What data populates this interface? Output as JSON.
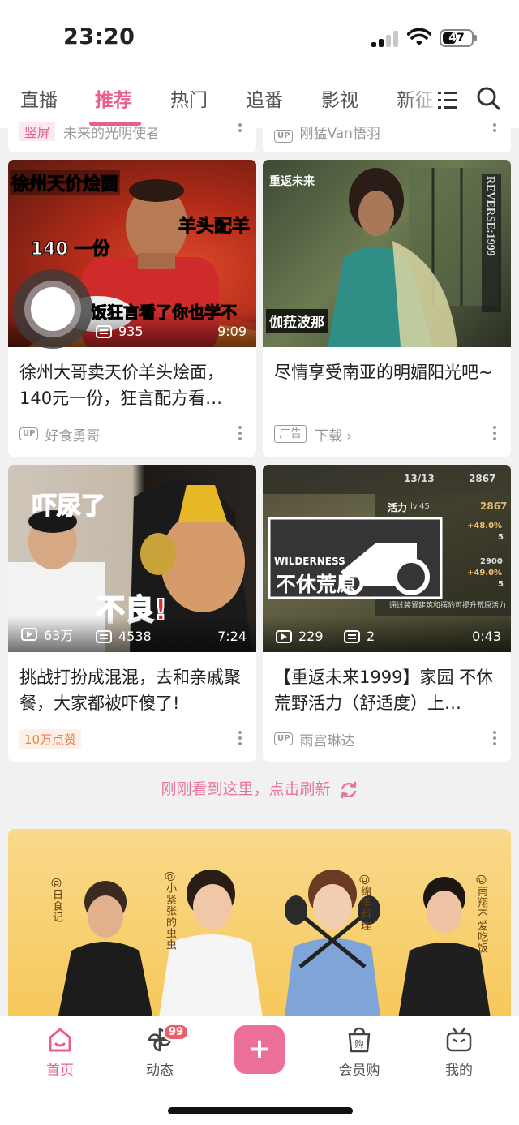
{
  "status_bar": {
    "time": "23:20",
    "battery": "47",
    "battery_level": 0.47
  },
  "tabs": [
    {
      "label": "直播"
    },
    {
      "label": "推荐"
    },
    {
      "label": "热门"
    },
    {
      "label": "追番"
    },
    {
      "label": "影视"
    },
    {
      "label": "新征"
    }
  ],
  "active_tab": "推荐",
  "top_remnants": {
    "left_tag": "竖屏",
    "left_text": "未来的光明使者",
    "right_text": "刚猛Van悟羽"
  },
  "cards": [
    {
      "overlay": [
        "徐州天价烩面",
        "140 一份",
        "羊头配羊",
        "饭狂言看了你也学不"
      ],
      "views": "",
      "danmaku": "935",
      "duration": "9:09",
      "title": "徐州大哥卖天价羊头烩面，140元一份，狂言配方看…",
      "author": "好食勇哥",
      "footer_type": "up"
    },
    {
      "overlay": [
        "重返未来",
        "REVERSE:1999",
        "伽菈波那"
      ],
      "views": "",
      "danmaku": "",
      "duration": "",
      "title": "尽情享受南亚的明媚阳光吧~",
      "ad_label": "广告",
      "ad_action": "下载 ›",
      "footer_type": "ad"
    },
    {
      "overlay": [
        "吓尿了",
        "不良!"
      ],
      "views": "63万",
      "danmaku": "4538",
      "duration": "7:24",
      "title": "挑战打扮成混混，去和亲戚聚餐，大家都被吓傻了!",
      "like_badge": "10万点赞",
      "footer_type": "like"
    },
    {
      "overlay": [
        "13/13",
        "2867",
        "活力",
        "lv.45",
        "2867",
        "+48.0%",
        "5",
        "2900",
        "+49.0%",
        "5",
        "WILDERNESS",
        "不休荒原",
        "通过装置建筑和摆豹可提升荒原活力"
      ],
      "views": "229",
      "danmaku": "2",
      "duration": "0:43",
      "title": "【重返未来1999】家园 不休荒野活力（舒适度）上…",
      "author": "雨宫琳达",
      "footer_type": "up"
    }
  ],
  "up_badge": "UP",
  "refresh_text": "刚刚看到这里，点击刷新",
  "banner_labels": [
    "@日食记",
    "@小紧张的虫虫",
    "@绵羊料理",
    "@南翔不爱吃饭"
  ],
  "bottom_nav": [
    {
      "label": "首页",
      "icon": "home-icon"
    },
    {
      "label": "动态",
      "icon": "pinwheel-icon",
      "badge": "99"
    },
    {
      "label": "",
      "icon": "plus-icon",
      "symbol": "+"
    },
    {
      "label": "会员购",
      "icon": "shopping-bag-icon"
    },
    {
      "label": "我的",
      "icon": "tv-icon"
    }
  ],
  "colors": {
    "accent": "#e85f8e",
    "orange": "#f08148"
  }
}
